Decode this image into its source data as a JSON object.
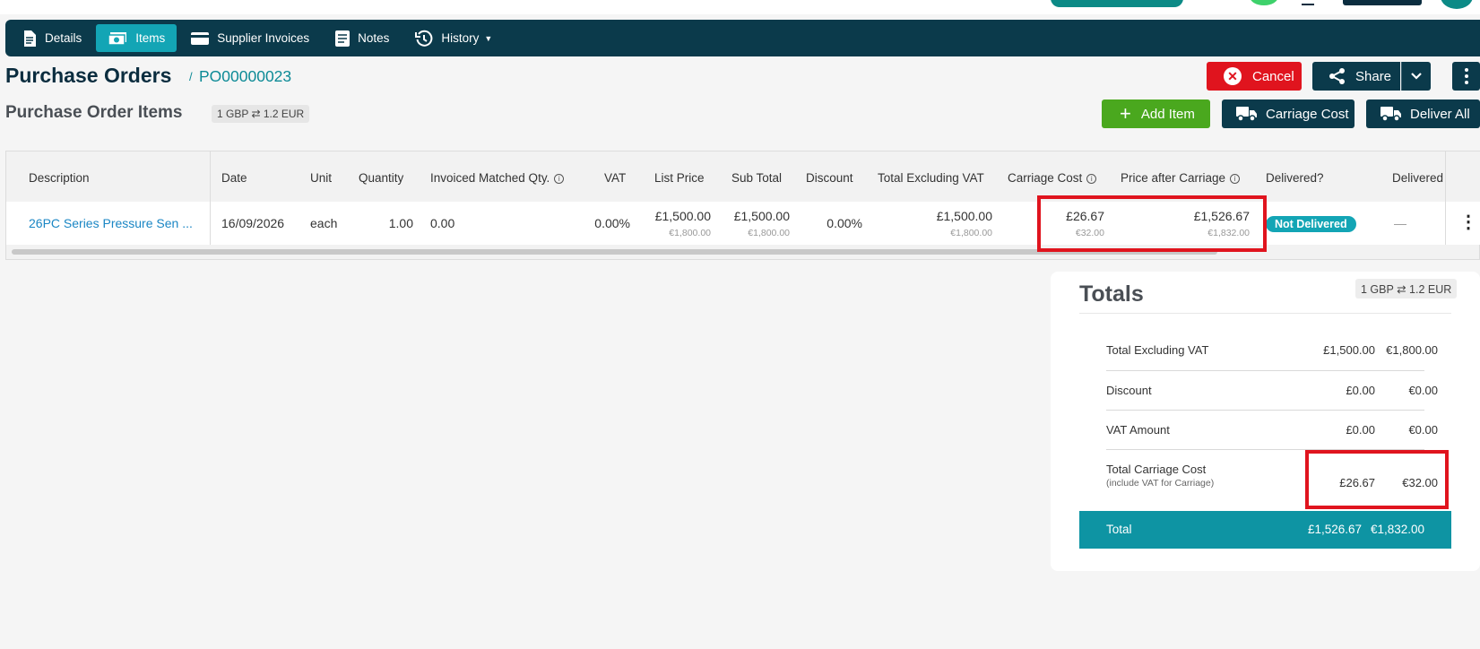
{
  "nav": {
    "tabs": [
      {
        "label": "Details",
        "icon": "document-icon",
        "active": false
      },
      {
        "label": "Items",
        "icon": "money-icon",
        "active": true
      },
      {
        "label": "Supplier Invoices",
        "icon": "card-icon",
        "active": false
      },
      {
        "label": "Notes",
        "icon": "notes-icon",
        "active": false
      },
      {
        "label": "History",
        "icon": "history-icon",
        "active": false
      }
    ]
  },
  "header": {
    "title": "Purchase Orders",
    "separator": "/",
    "po_number": "PO00000023",
    "cancel_label": "Cancel",
    "share_label": "Share"
  },
  "section": {
    "title": "Purchase Order Items",
    "rate": "1 GBP ⇄ 1.2 EUR",
    "add_item_label": "Add Item",
    "carriage_label": "Carriage Cost",
    "deliver_label": "Deliver All"
  },
  "table": {
    "columns": [
      "Description",
      "Date",
      "Unit",
      "Quantity",
      "Invoiced Matched Qty.",
      "VAT",
      "List Price",
      "Sub Total",
      "Discount",
      "Total Excluding VAT",
      "Carriage Cost",
      "Price after Carriage",
      "Delivered?",
      "Delivered"
    ],
    "row": {
      "description": "26PC Series Pressure Sen ...",
      "date": "16/09/2026",
      "unit": "each",
      "quantity": "1.00",
      "invoiced_matched": "0.00",
      "vat": "0.00%",
      "list_price": "£1,500.00",
      "list_price_eur": "€1,800.00",
      "sub_total": "£1,500.00",
      "sub_total_eur": "€1,800.00",
      "discount": "0.00%",
      "total_ex_vat": "£1,500.00",
      "total_ex_vat_eur": "€1,800.00",
      "carriage": "£26.67",
      "carriage_eur": "€32.00",
      "price_after_carriage": "£1,526.67",
      "price_after_carriage_eur": "€1,832.00",
      "delivered_status": "Not Delivered",
      "delivered": "—"
    }
  },
  "totals": {
    "title": "Totals",
    "rate": "1 GBP ⇄ 1.2 EUR",
    "rows": [
      {
        "label": "Total Excluding VAT",
        "gbp": "£1,500.00",
        "eur": "€1,800.00"
      },
      {
        "label": "Discount",
        "gbp": "£0.00",
        "eur": "€0.00"
      },
      {
        "label": "VAT Amount",
        "gbp": "£0.00",
        "eur": "€0.00"
      },
      {
        "label": "Total Carriage Cost",
        "note": "(include VAT for Carriage)",
        "gbp": "£26.67",
        "eur": "€32.00"
      }
    ],
    "total": {
      "label": "Total",
      "gbp": "£1,526.67",
      "eur": "€1,832.00"
    }
  },
  "colors": {
    "navy": "#0b3a4b",
    "teal": "#13a5b5",
    "danger": "#e0141e",
    "success": "#4aa81e",
    "highlight": "#e0141e"
  }
}
